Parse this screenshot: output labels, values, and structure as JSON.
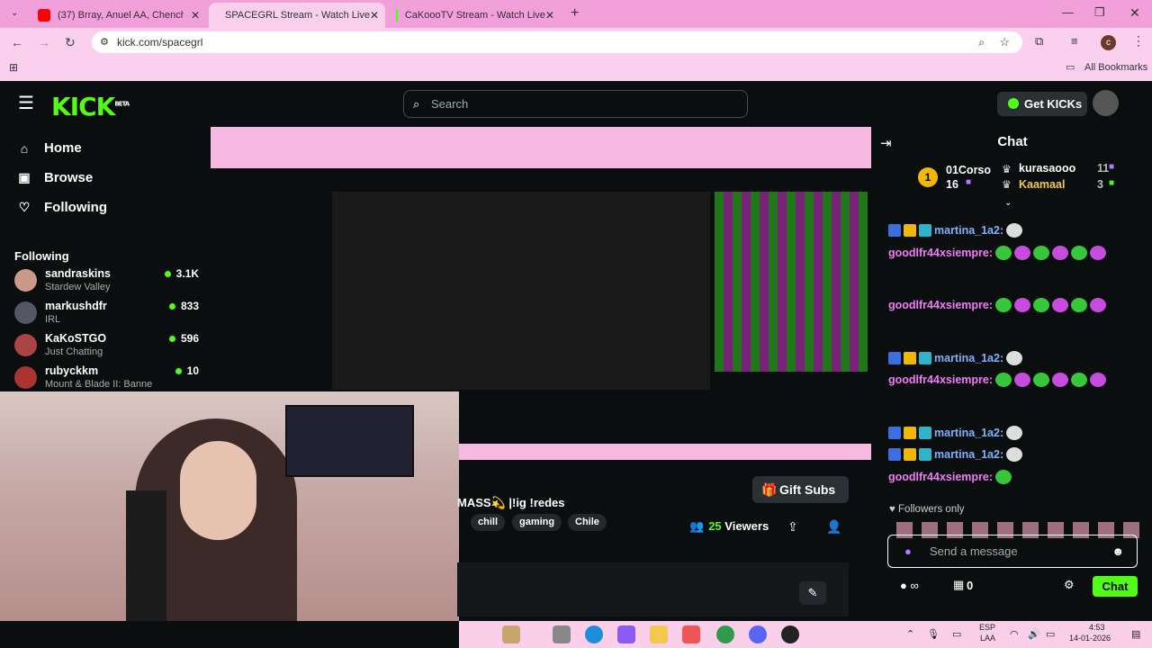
{
  "browser": {
    "tabs": [
      {
        "title": "(37) Brray, Anuel AA, Chencho C...",
        "color": "#ff0000"
      },
      {
        "title": "SPACEGRL Stream - Watch Live",
        "color": "#53fc18"
      },
      {
        "title": "CaKoooTV Stream - Watch Live",
        "color": "#53fc18"
      }
    ],
    "url": "kick.com/spacegrl",
    "bookmarks_label": "All Bookmarks",
    "profile_initial": "c"
  },
  "kick": {
    "logo": "KICK",
    "logo_badge": "BETA",
    "search_placeholder": "Search",
    "get_kicks": "Get KICKs",
    "nav": [
      {
        "label": "Home",
        "icon": "home-icon"
      },
      {
        "label": "Browse",
        "icon": "browse-icon"
      },
      {
        "label": "Following",
        "icon": "heart-icon"
      }
    ],
    "following_heading": "Following",
    "following": [
      {
        "name": "sandraskins",
        "game": "Stardew Valley",
        "viewers": "3.1K",
        "color": "#c98"
      },
      {
        "name": "markushdfr",
        "game": "IRL",
        "viewers": "833",
        "color": "#556"
      },
      {
        "name": "KaKoSTGO",
        "game": "Just Chatting",
        "viewers": "596",
        "color": "#a44"
      },
      {
        "name": "rubyckkm",
        "game": "Mount & Blade II: Banne",
        "viewers": "10",
        "color": "#a33"
      }
    ]
  },
  "stream": {
    "title": "MASS💫 |!ig !redes",
    "tags": [
      "chill",
      "gaming",
      "Chile"
    ],
    "gift_subs": "Gift Subs",
    "viewers_count": "25",
    "viewers_label": "Viewers"
  },
  "chat": {
    "title": "Chat",
    "leaderboard": [
      {
        "rank": "1",
        "name": "01Corso",
        "count": "16"
      },
      {
        "name": "kurasaooo",
        "count": "11"
      },
      {
        "name": "Kaamaal",
        "count": "3"
      }
    ],
    "messages": [
      {
        "user": "martina_1a2:",
        "color": "blue",
        "emotes": 1
      },
      {
        "user": "goodlfr44xsiempre:",
        "color": "pink",
        "emotes": 10
      },
      {
        "user": "goodlfr44xsiempre:",
        "color": "pink",
        "emotes": 10
      },
      {
        "user": "martina_1a2:",
        "color": "blue",
        "emotes": 1
      },
      {
        "user": "goodlfr44xsiempre:",
        "color": "pink",
        "emotes": 8
      },
      {
        "user": "martina_1a2:",
        "color": "blue",
        "emotes": 1
      },
      {
        "user": "martina_1a2:",
        "color": "blue",
        "emotes": 1
      },
      {
        "user": "goodlfr44xsiempre:",
        "color": "pink",
        "emotes": 1
      }
    ],
    "followers_only": "Followers only",
    "input_placeholder": "Send a message",
    "points": "0",
    "send_label": "Chat"
  },
  "taskbar": {
    "lang": "ESP",
    "layout": "LAA",
    "time": "4:53",
    "date": "14-01-2026"
  },
  "colors": {
    "accent": "#53fc18",
    "pink_chrome": "#f2a0d9",
    "bg": "#0b0e0f"
  }
}
